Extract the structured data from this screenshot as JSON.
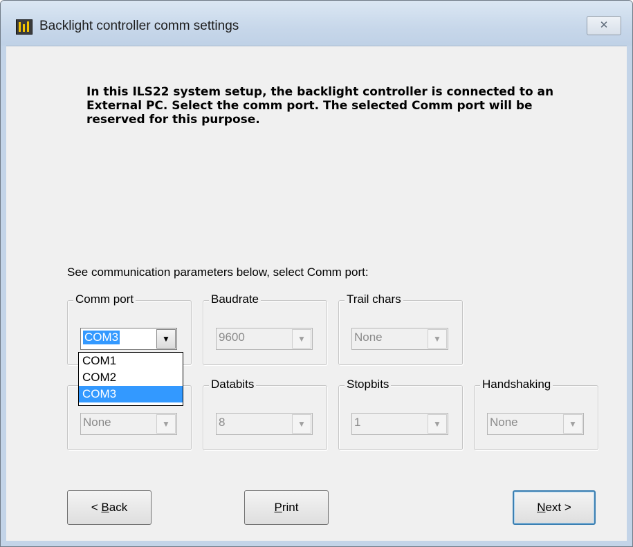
{
  "window": {
    "title": "Backlight controller comm settings",
    "close_glyph": "✕",
    "icon": "app-icon"
  },
  "intro_text": "In this ILS22 system setup, the backlight controller is connected to an External PC. Select the comm port. The selected Comm port will be reserved for this purpose.",
  "select_hint": "See communication parameters below, select Comm port:",
  "groups": {
    "comm_port": {
      "label": "Comm port",
      "value": "COM3"
    },
    "baudrate": {
      "label": "Baudrate",
      "value": "9600"
    },
    "trail_chars": {
      "label": "Trail chars",
      "value": "None"
    },
    "parity": {
      "label": "",
      "value": "None"
    },
    "databits": {
      "label": "Databits",
      "value": "8"
    },
    "stopbits": {
      "label": "Stopbits",
      "value": "1"
    },
    "handshaking": {
      "label": "Handshaking",
      "value": "None"
    }
  },
  "comm_port_dropdown": {
    "options": [
      "COM1",
      "COM2",
      "COM3"
    ],
    "selected": "COM3"
  },
  "buttons": {
    "back": {
      "underline": "B",
      "prefix": "< ",
      "rest": "ack"
    },
    "print": {
      "underline": "P",
      "prefix": "",
      "rest": "rint"
    },
    "next": {
      "underline": "N",
      "prefix": "",
      "rest": "ext >"
    }
  },
  "colors": {
    "selection": "#3399ff",
    "dialog_bg": "#f0f0f0"
  }
}
